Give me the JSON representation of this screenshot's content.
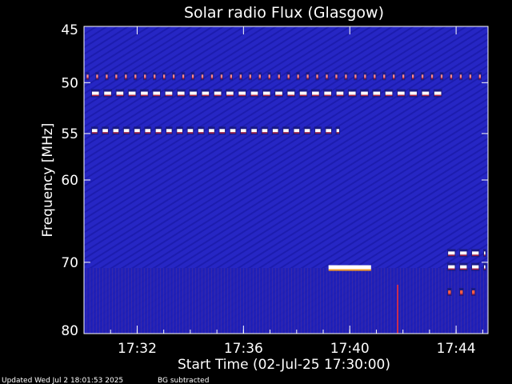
{
  "chart_data": {
    "type": "heatmap",
    "title": "Solar radio Flux (Glasgow)",
    "xlabel": "Start Time (02-Jul-25 17:30:00)",
    "ylabel": "Frequency [MHz]",
    "x_unit": "minutes after 17:30",
    "xlim": [
      0,
      15.2
    ],
    "ylim": [
      45,
      80
    ],
    "y_scale": "log",
    "grid": false,
    "x_ticks": [
      {
        "value": 2,
        "label": "17:32"
      },
      {
        "value": 6,
        "label": "17:36"
      },
      {
        "value": 10,
        "label": "17:40"
      },
      {
        "value": 14,
        "label": "17:44"
      }
    ],
    "y_ticks": [
      {
        "value": 45,
        "label": "45"
      },
      {
        "value": 50,
        "label": "50"
      },
      {
        "value": 55,
        "label": "55"
      },
      {
        "value": 60,
        "label": "60"
      },
      {
        "value": 70,
        "label": "70"
      },
      {
        "value": 80,
        "label": "80"
      }
    ],
    "colors": {
      "background": "#2828c8",
      "low": "#1a1aa8",
      "mid": "#b02040",
      "high": "#ffffff",
      "peak": "#ffa020"
    },
    "features": [
      {
        "kind": "intermittent_band",
        "freq_mhz": 49.4,
        "t_start": 0.1,
        "t_end": 15.1,
        "period_min": 0.36,
        "on_min": 0.07,
        "color": "#ff8888"
      },
      {
        "kind": "intermittent_band",
        "freq_mhz": 51.0,
        "t_start": 0.3,
        "t_end": 13.6,
        "period_min": 0.46,
        "on_min": 0.26,
        "color": "#ffffff"
      },
      {
        "kind": "intermittent_band",
        "freq_mhz": 54.7,
        "t_start": 0.3,
        "t_end": 9.6,
        "period_min": 0.4,
        "on_min": 0.2,
        "color": "#ffffff"
      },
      {
        "kind": "burst",
        "freq_mhz": 70.7,
        "t_start": 9.2,
        "t_end": 10.8,
        "color": "#ffffff"
      },
      {
        "kind": "intermittent_band",
        "freq_mhz": 68.8,
        "t_start": 13.7,
        "t_end": 15.1,
        "period_min": 0.45,
        "on_min": 0.25,
        "color": "#ffffff"
      },
      {
        "kind": "intermittent_band",
        "freq_mhz": 70.6,
        "t_start": 13.7,
        "t_end": 15.1,
        "period_min": 0.45,
        "on_min": 0.25,
        "color": "#ffffff"
      },
      {
        "kind": "intermittent_band",
        "freq_mhz": 74.0,
        "t_start": 13.7,
        "t_end": 14.9,
        "period_min": 0.45,
        "on_min": 0.1,
        "color": "#ff6040"
      },
      {
        "kind": "spike",
        "freq_mhz_start": 73.0,
        "freq_mhz_end": 80.0,
        "t": 11.8,
        "color": "#ff3030"
      }
    ]
  },
  "footer": {
    "updated": "Updated Wed Jul  2 18:01:53 2025",
    "note": "BG subtracted"
  }
}
